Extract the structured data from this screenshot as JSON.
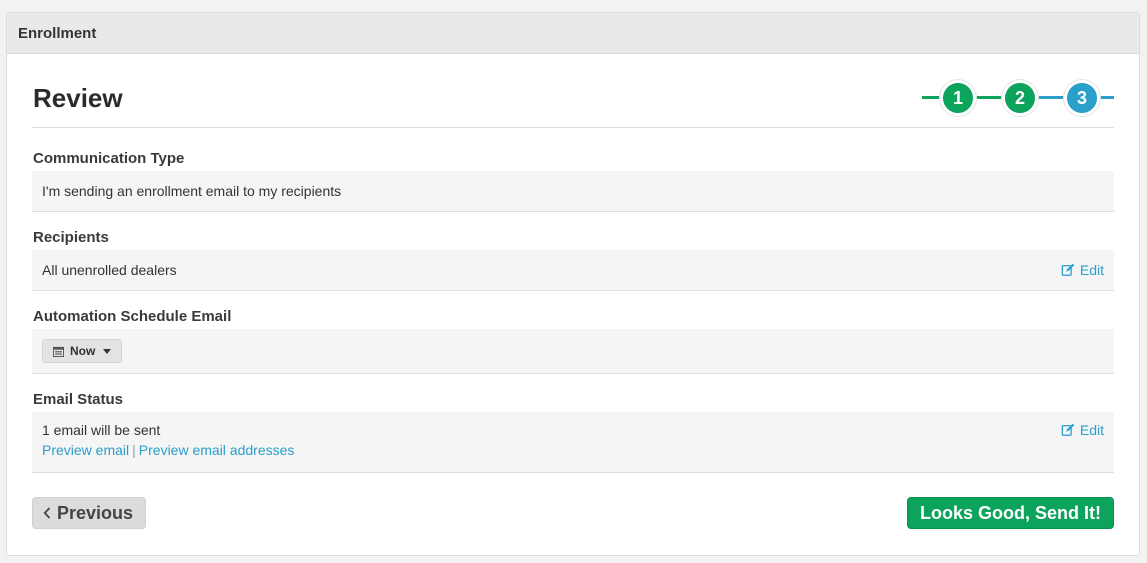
{
  "panel": {
    "header_title": "Enrollment"
  },
  "page": {
    "title": "Review"
  },
  "stepper": {
    "steps": [
      {
        "label": "1",
        "state": "complete"
      },
      {
        "label": "2",
        "state": "complete"
      },
      {
        "label": "3",
        "state": "active"
      }
    ],
    "colors": {
      "complete": "#0ca35c",
      "active": "#2a9fc9"
    }
  },
  "sections": {
    "communication_type": {
      "label": "Communication Type",
      "value": "I'm sending an enrollment email to my recipients"
    },
    "recipients": {
      "label": "Recipients",
      "value": "All unenrolled dealers",
      "edit_label": "Edit"
    },
    "automation_schedule": {
      "label": "Automation Schedule Email",
      "selected": "Now"
    },
    "email_status": {
      "label": "Email Status",
      "value": "1 email will be sent",
      "preview_email": "Preview email",
      "separator": "|",
      "preview_addresses": "Preview email addresses",
      "edit_label": "Edit"
    }
  },
  "footer": {
    "previous_label": "Previous",
    "send_label": "Looks Good, Send It!"
  }
}
